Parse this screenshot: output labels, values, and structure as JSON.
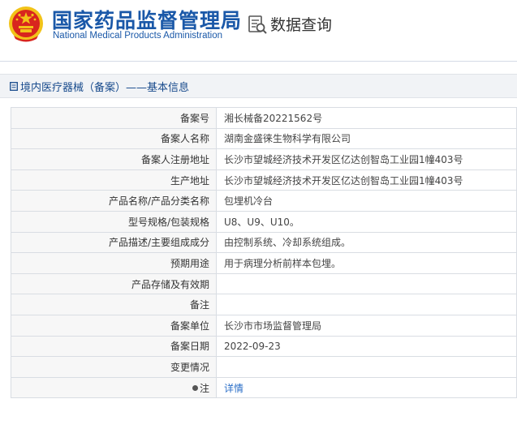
{
  "header": {
    "title_cn": "国家药品监督管理局",
    "title_en": "National Medical Products Administration",
    "query_label": "数据查询"
  },
  "section": {
    "title": "境内医疗器械（备案）——基本信息"
  },
  "fields": [
    {
      "label": "备案号",
      "value": "湘长械备20221562号"
    },
    {
      "label": "备案人名称",
      "value": "湖南金盛徕生物科学有限公司"
    },
    {
      "label": "备案人注册地址",
      "value": "长沙市望城经济技术开发区亿达创智岛工业园1幢403号"
    },
    {
      "label": "生产地址",
      "value": "长沙市望城经济技术开发区亿达创智岛工业园1幢403号"
    },
    {
      "label": "产品名称/产品分类名称",
      "value": "包埋机冷台"
    },
    {
      "label": "型号规格/包装规格",
      "value": "U8、U9、U10。"
    },
    {
      "label": "产品描述/主要组成成分",
      "value": "由控制系统、冷却系统组成。"
    },
    {
      "label": "预期用途",
      "value": "用于病理分析前样本包埋。"
    },
    {
      "label": "产品存储及有效期",
      "value": ""
    },
    {
      "label": "备注",
      "value": ""
    },
    {
      "label": "备案单位",
      "value": "长沙市市场监督管理局"
    },
    {
      "label": "备案日期",
      "value": "2022-09-23"
    },
    {
      "label": "变更情况",
      "value": ""
    },
    {
      "label": "注",
      "value": "详情"
    }
  ],
  "colors": {
    "brand_blue": "#1a58a8",
    "link_blue": "#2a6ec7",
    "emblem_red": "#d8251e",
    "emblem_gold": "#f2c318"
  },
  "icons": [
    "national-emblem-icon",
    "data-query-icon",
    "document-icon",
    "info-dot-icon"
  ]
}
